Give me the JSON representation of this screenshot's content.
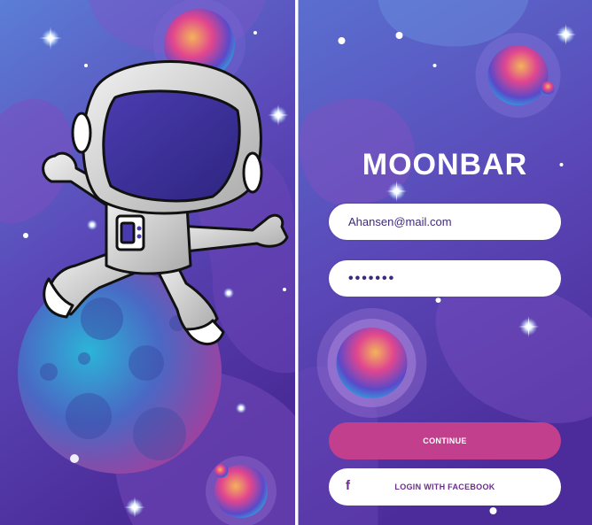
{
  "app": {
    "brand": "MOONBAR"
  },
  "login": {
    "email_value": "Ahansen@mail.com",
    "password_value": "•••••••",
    "continue_label": "CONTINUE",
    "facebook_label": "LOGIN WITH FACEBOOK",
    "facebook_icon": "facebook-f-icon"
  },
  "theme": {
    "background_top": "#5a6fd0",
    "background_bottom": "#4b2c9a",
    "accent_pink": "#c23f8d",
    "text_purple": "#6a2d8c"
  }
}
